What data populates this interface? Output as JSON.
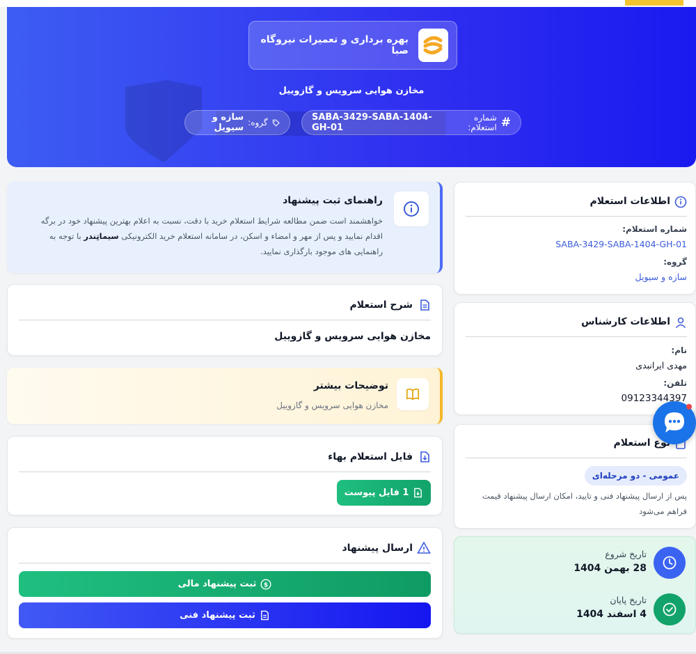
{
  "header": {
    "brand_title": "بهره برداری و تعمیرات نیروگاه صبا",
    "subtitle": "مخازن هوایی سرویس و گازوییل",
    "inquiry_label": "شماره استعلام:",
    "inquiry_value": "SABA-3429-SABA-1404-GH-01",
    "group_label": "گروه:",
    "group_value": "سازه و سیویل"
  },
  "guide": {
    "title": "راهنمای ثبت پیشنهاد",
    "line1": "خواهشمند است ضمن مطالعه شرایط استعلام خرید با دقت، نسبت به اعلام بهترین پیشنهاد خود در برگه",
    "line2a": "اقدام نمایید و پس از مهر و امضاء و اسکن، در سامانه استعلام خرید الکترونیکی",
    "line2b": "سیماتِندر",
    "line2c": "با توجه به",
    "line3": "راهنمایی های موجود بارگذاری نمایید."
  },
  "description": {
    "title": "شرح استعلام",
    "text": "مخازن هوایی سرویس و گازوییل"
  },
  "more": {
    "title": "توضیحات بیشتر",
    "text": "مخازن هوایی سرویس و گازوییل"
  },
  "file": {
    "title": "فایل استعلام بهاء",
    "button": "1 فایل پیوست"
  },
  "submit": {
    "title": "ارسال پیشنهاد",
    "financial_button": "ثبت پیشنهاد مالی",
    "technical_button": "ثبت پیشنهاد فنی"
  },
  "info": {
    "title": "اطلاعات استعلام",
    "number_label": "شماره استعلام:",
    "number_value": "SABA-3429-SABA-1404-GH-01",
    "group_label": "گروه:",
    "group_value": "سازه و سیویل"
  },
  "expert": {
    "title": "اطلاعات کارشناس",
    "name_label": "نام:",
    "name_value": "مهدی ایرانبدی",
    "phone_label": "تلفن:",
    "phone_value": "09123344397"
  },
  "type": {
    "title": "نوع استعلام",
    "badge": "عمومی - دو مرحله‌ای",
    "line1": "پس از ارسال پیشنهاد فنی و تایید، امکان ارسال پیشنهاد قیمت",
    "line2": "فراهم می‌شود"
  },
  "dates": {
    "start_label": "تاریخ شروع",
    "start_value": "28 بهمن 1404",
    "end_label": "تاریخ پایان",
    "end_value": "4 اسفند 1404"
  },
  "colors": {
    "primary": "#2f2ff0",
    "green": "#12a36a",
    "amber": "#f5b829",
    "info_accent": "#4f6cf7"
  }
}
